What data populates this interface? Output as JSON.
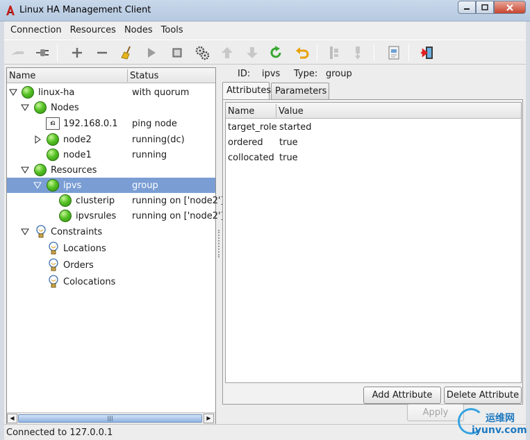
{
  "window": {
    "title": "Linux HA Management Client"
  },
  "menubar": [
    "Connection",
    "Resources",
    "Nodes",
    "Tools"
  ],
  "toolbar": {
    "icons": [
      "disconnect-icon",
      "connect-icon",
      "add-icon",
      "remove-icon",
      "cleanup-broom-icon",
      "start-icon",
      "stop-icon",
      "default-settings-gears-icon",
      "move-up-icon",
      "move-down-icon",
      "refresh-icon",
      "undo-icon",
      "standby-node-icon",
      "active-node-icon",
      "view-xml-icon",
      "exit-icon"
    ]
  },
  "tree": {
    "columns": {
      "name": "Name",
      "status": "Status"
    },
    "rows": [
      {
        "label": "linux-ha",
        "status": "with quorum",
        "icon": "green-status-icon"
      },
      {
        "label": "Nodes",
        "status": "",
        "icon": "green-status-icon"
      },
      {
        "label": "192.168.0.1",
        "status": "ping node",
        "icon": "ping-node-icon"
      },
      {
        "label": "node2",
        "status": "running(dc)",
        "icon": "green-status-icon"
      },
      {
        "label": "node1",
        "status": "running",
        "icon": "green-status-icon"
      },
      {
        "label": "Resources",
        "status": "",
        "icon": "green-status-icon"
      },
      {
        "label": "ipvs",
        "status": "group",
        "icon": "green-status-icon",
        "selected": true
      },
      {
        "label": "clusterip",
        "status": "running on ['node2']",
        "icon": "green-status-icon"
      },
      {
        "label": "ipvsrules",
        "status": "running on ['node2']",
        "icon": "green-status-icon"
      },
      {
        "label": "Constraints",
        "status": "",
        "icon": "lightbulb-icon"
      },
      {
        "label": "Locations",
        "status": "",
        "icon": "lightbulb-icon"
      },
      {
        "label": "Orders",
        "status": "",
        "icon": "lightbulb-icon"
      },
      {
        "label": "Colocations",
        "status": "",
        "icon": "lightbulb-icon"
      }
    ]
  },
  "details": {
    "id_label": "ID:",
    "id_value": "ipvs",
    "type_label": "Type:",
    "type_value": "group",
    "tabs": [
      "Attributes",
      "Parameters"
    ],
    "active_tab": "Attributes",
    "table": {
      "columns": {
        "name": "Name",
        "value": "Value"
      },
      "rows": [
        {
          "name": "target_role",
          "value": "started"
        },
        {
          "name": "ordered",
          "value": "true"
        },
        {
          "name": "collocated",
          "value": "true"
        }
      ]
    },
    "buttons": {
      "add": "Add Attribute",
      "delete": "Delete Attribute",
      "apply": "Apply"
    }
  },
  "statusbar": {
    "text": "Connected to 127.0.0.1"
  },
  "watermark": {
    "cn": "运维网",
    "url": "iyunv.com"
  }
}
